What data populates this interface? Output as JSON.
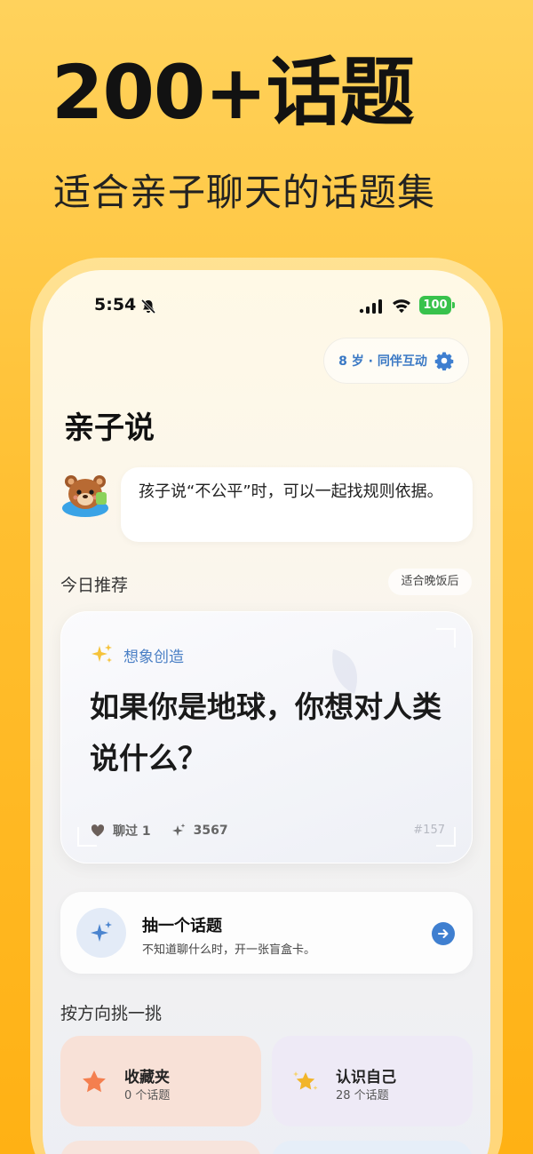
{
  "hero": {
    "title": "200+话题",
    "subtitle": "适合亲子聊天的话题集"
  },
  "status_bar": {
    "time": "5:54",
    "battery": "100",
    "icons": [
      "bell-slash-icon",
      "signal-icon",
      "wifi-icon",
      "battery-icon"
    ]
  },
  "header": {
    "age_mode": "8 岁 · 同伴互动",
    "app_title": "亲子说"
  },
  "tip": {
    "text": "孩子说“不公平”时，可以一起找规则依据。"
  },
  "today": {
    "section_title": "今日推荐",
    "scene_tag": "适合晚饭后",
    "category": "想象创造",
    "question": "如果你是地球，你想对人类说什么？",
    "chatted": "聊过 1",
    "count": "3567",
    "topic_number": "#157"
  },
  "draw": {
    "title": "抽一个话题",
    "subtitle": "不知道聊什么时，开一张盲盒卡。"
  },
  "directions": {
    "section_title": "按方向挑一挑",
    "items": [
      {
        "title": "收藏夹",
        "sub": "0 个话题",
        "icon": "star-icon",
        "color": "#f47f4f"
      },
      {
        "title": "认识自己",
        "sub": "28 个话题",
        "icon": "sparkle-star-icon",
        "color": "#f2b52a"
      }
    ]
  },
  "colors": {
    "accent_blue": "#3f7fd0",
    "background": "#ffc02e",
    "battery_green": "#38c24c"
  }
}
